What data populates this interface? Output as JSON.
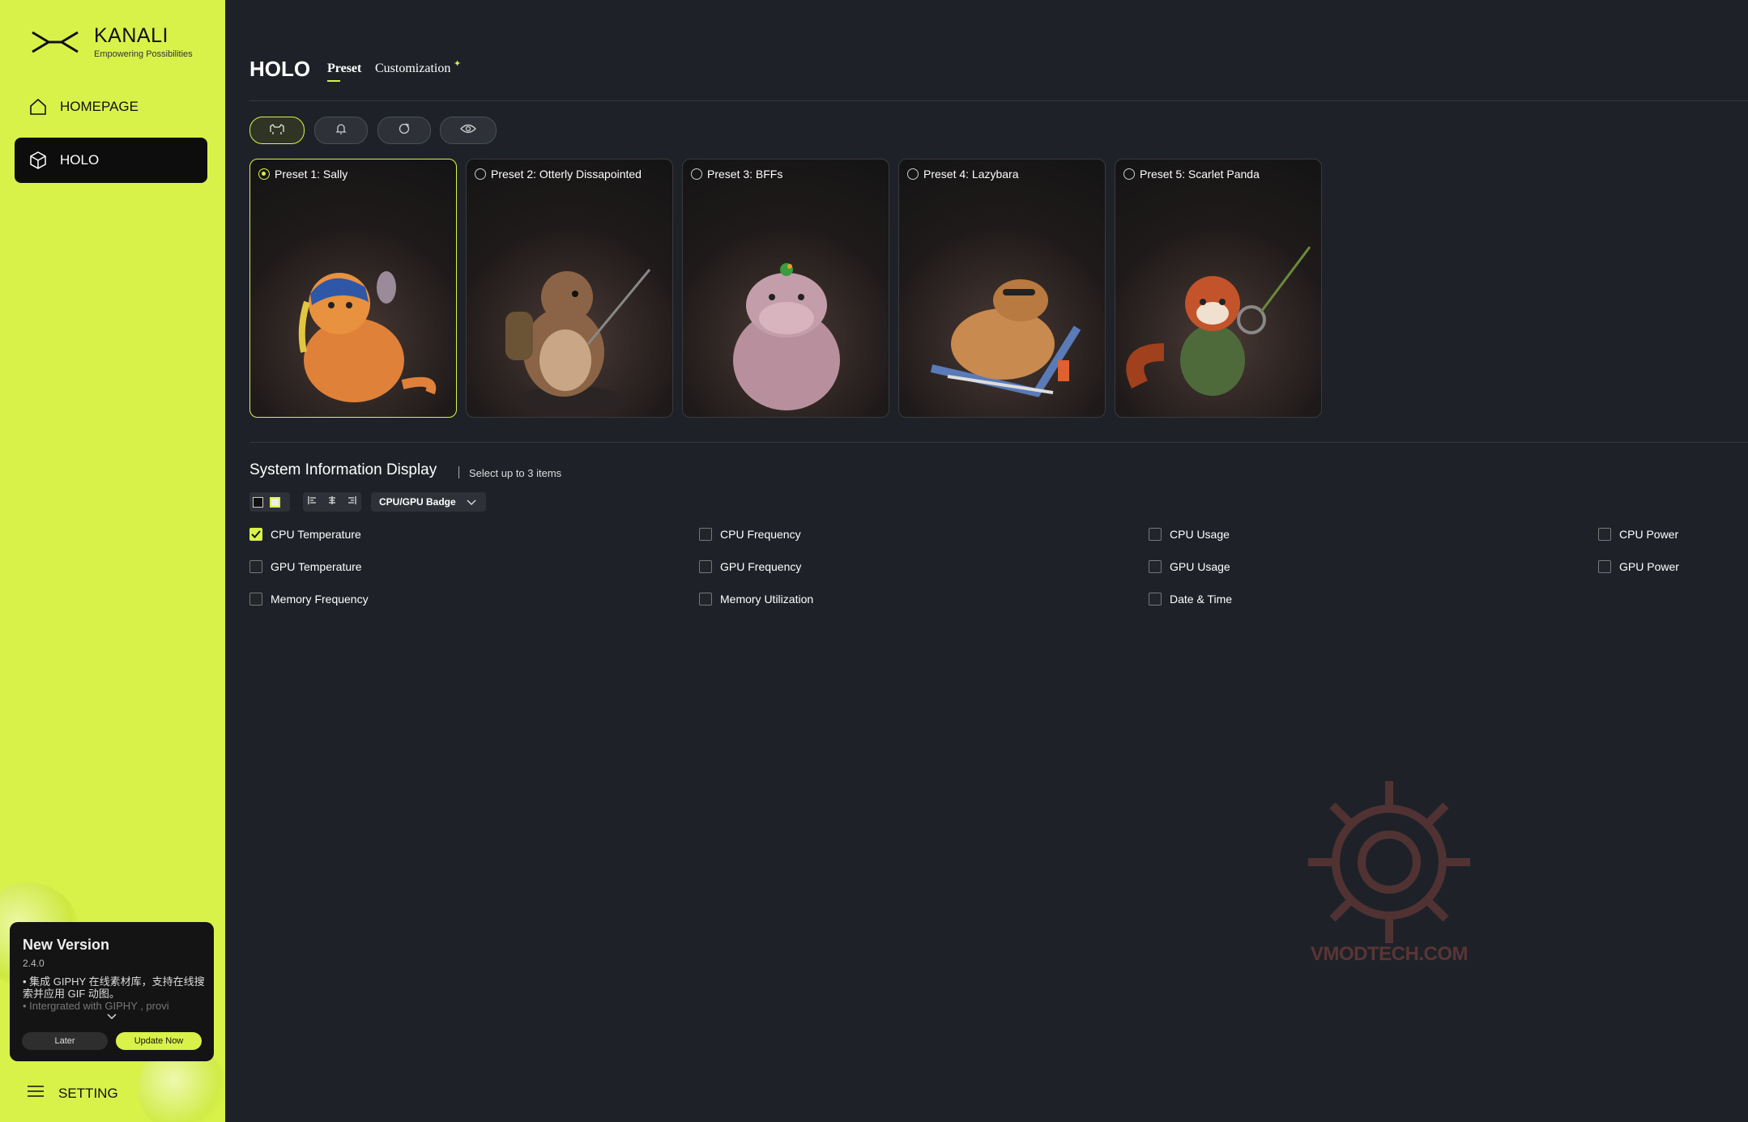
{
  "app": {
    "brand": "KANALI",
    "tagline": "Empowering Possibilities"
  },
  "sidebar": {
    "items": [
      {
        "label": "HOMEPAGE",
        "icon": "home-icon"
      },
      {
        "label": "HOLO",
        "icon": "cube-icon",
        "active": true
      }
    ],
    "setting_label": "SETTING"
  },
  "update": {
    "title": "New Version",
    "version": "2.4.0",
    "note1": "• 集成 GIPHY 在线素材库，支持在线搜索并应用 GIF 动图。",
    "note2": "• Intergrated with GIPHY , provi",
    "later": "Later",
    "update_now": "Update Now"
  },
  "header": {
    "title": "HOLO",
    "tabs": [
      {
        "label": "Preset",
        "active": true
      },
      {
        "label": "Customization"
      }
    ]
  },
  "filters": [
    "animal-icon",
    "bell-icon",
    "refresh-icon",
    "eye-icon"
  ],
  "presets": [
    {
      "label": "Preset 1:  Sally",
      "selected": true
    },
    {
      "label": "Preset 2:  Otterly Dissapointed"
    },
    {
      "label": "Preset 3:  BFFs"
    },
    {
      "label": "Preset 4:  Lazybara"
    },
    {
      "label": "Preset 5:  Scarlet Panda"
    }
  ],
  "system": {
    "title": "System Information Display",
    "subtitle": "Select up to 3 items",
    "dropdown": "CPU/GPU Badge",
    "options": [
      {
        "label": "CPU Temperature",
        "checked": true
      },
      {
        "label": "CPU Frequency"
      },
      {
        "label": "CPU Usage"
      },
      {
        "label": "CPU Power"
      },
      {
        "label": "GPU Temperature"
      },
      {
        "label": "GPU Frequency"
      },
      {
        "label": "GPU Usage"
      },
      {
        "label": "GPU Power"
      },
      {
        "label": "Memory Frequency"
      },
      {
        "label": "Memory Utilization"
      },
      {
        "label": "Date & Time"
      }
    ]
  },
  "watermark": "VMODTECH.COM",
  "colors": {
    "accent": "#d9f24a",
    "background": "#1e2228",
    "sidebar": "#d9f24a"
  }
}
